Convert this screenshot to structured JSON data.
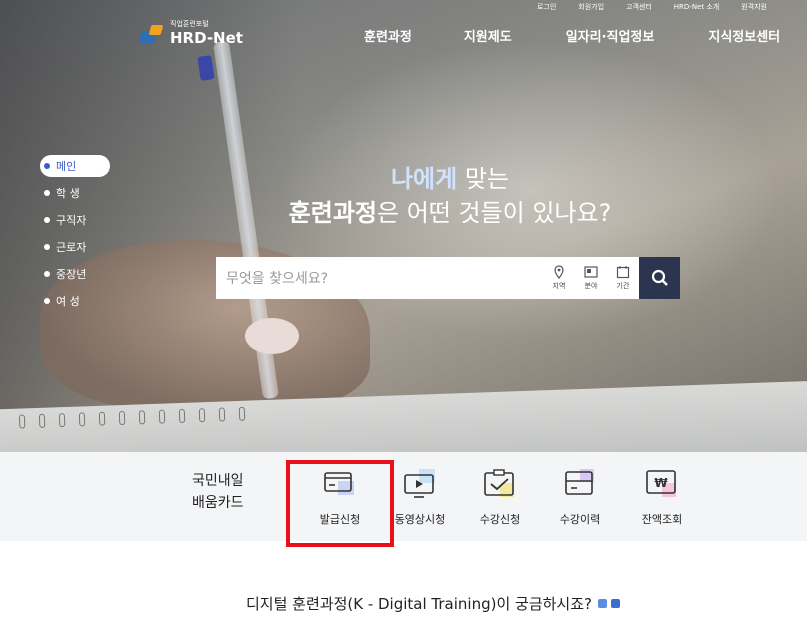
{
  "utility": [
    "로그인",
    "회원가입",
    "고객센터",
    "HRD-Net 소개",
    "원격지원"
  ],
  "logo": {
    "small": "직업훈련포털",
    "big": "HRD-Net"
  },
  "nav": [
    "훈련과정",
    "지원제도",
    "일자리·직업정보",
    "지식정보센터"
  ],
  "side_menu": [
    "메인",
    "학 생",
    "구직자",
    "근로자",
    "중장년",
    "여 성"
  ],
  "headline": {
    "l1_accent": "나에게",
    "l1_rest": " 맞는",
    "l2_accent": "훈련과정",
    "l2_rest": "은 어떤 것들이 있나요?"
  },
  "search": {
    "placeholder": "무엇을 찾으세요?",
    "filters": [
      "지역",
      "분야",
      "기간"
    ]
  },
  "card": {
    "title_l1": "국민내일",
    "title_l2": "배움카드"
  },
  "services": [
    "발급신청",
    "동영상시청",
    "수강신청",
    "수강이력",
    "잔액조회"
  ],
  "digital": {
    "text": "디지털 훈련과정(K - Digital Training)이 궁금하시죠?"
  },
  "icons": [
    "location-icon",
    "field-icon",
    "calendar-icon",
    "search-icon",
    "card-icon",
    "video-icon",
    "apply-icon",
    "history-icon",
    "balance-icon"
  ]
}
